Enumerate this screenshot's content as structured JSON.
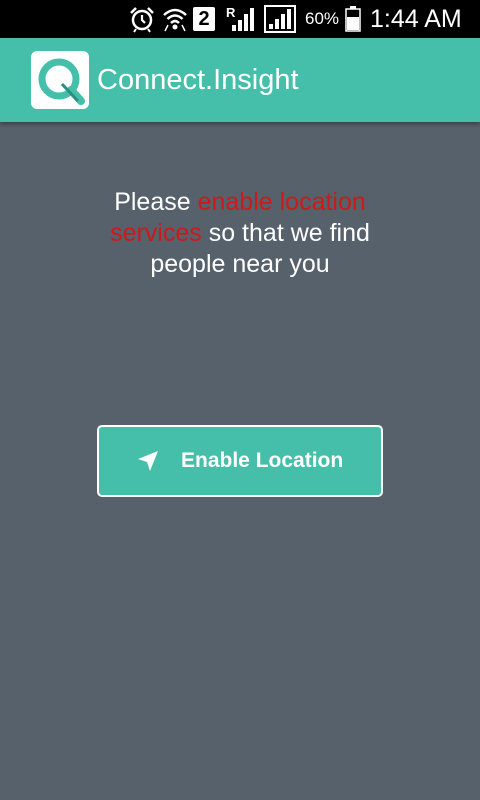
{
  "status_bar": {
    "sim_slot": "2",
    "roaming": "R",
    "battery_percent": "60%",
    "time": "1:44 AM",
    "icons": [
      "alarm-icon",
      "wifi-icon",
      "sim-2-icon",
      "roaming-signal-icon",
      "signal-icon",
      "battery-icon"
    ]
  },
  "app_bar": {
    "title": "Connect.Insight",
    "logo_icon": "magnifier-logo-icon",
    "color": "#45bfa9"
  },
  "message": {
    "text_before": "Please ",
    "highlight": "enable location services",
    "text_after": " so that we find people near you",
    "highlight_color": "#cc1a1a"
  },
  "enable_button": {
    "label": "Enable Location",
    "icon": "navigation-arrow-icon"
  },
  "colors": {
    "background": "#56616b",
    "accent": "#45bfa9"
  }
}
